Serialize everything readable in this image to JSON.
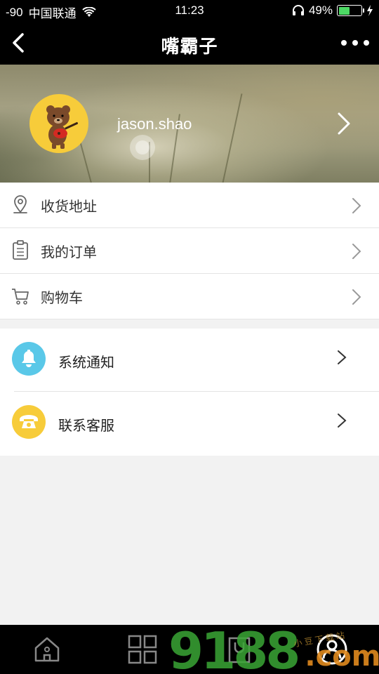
{
  "status_bar": {
    "signal": "-90",
    "carrier": "中国联通",
    "time": "11:23",
    "battery_percent": "49%",
    "battery_level": 0.49
  },
  "nav": {
    "title": "嘴霸子"
  },
  "profile": {
    "username": "jason.shao"
  },
  "menu": [
    {
      "label": "收货地址",
      "icon": "location-pin-icon"
    },
    {
      "label": "我的订单",
      "icon": "clipboard-icon"
    },
    {
      "label": "购物车",
      "icon": "shopping-cart-icon"
    }
  ],
  "menu2": [
    {
      "label": "系统通知",
      "icon": "bell-icon",
      "color": "#5ac8e8"
    },
    {
      "label": "联系客服",
      "icon": "telephone-icon",
      "color": "#f7cc3a"
    }
  ],
  "tabs": [
    {
      "name": "home",
      "icon": "home-icon"
    },
    {
      "name": "categories",
      "icon": "grid-icon"
    },
    {
      "name": "cart",
      "icon": "bag-icon"
    },
    {
      "name": "profile",
      "icon": "user-icon"
    }
  ],
  "watermark": {
    "main": "9188",
    "domain": ".com",
    "small": "小 豆 下 载 站"
  }
}
